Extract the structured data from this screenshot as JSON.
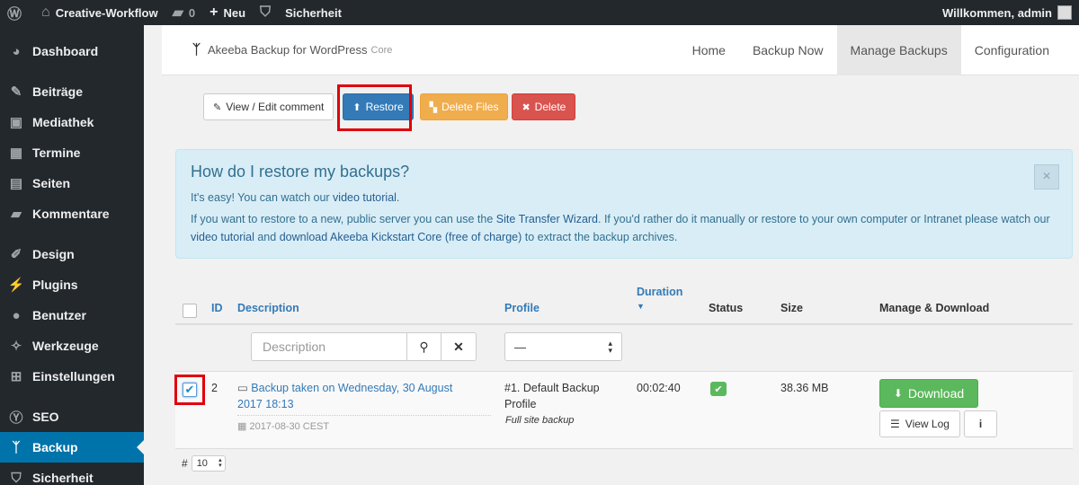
{
  "adminbar": {
    "site_name": "Creative-Workflow",
    "comments_count": "0",
    "new_label": "Neu",
    "security_label": "Sicherheit",
    "greeting": "Willkommen, admin"
  },
  "sidebar": {
    "items": [
      {
        "label": "Dashboard",
        "icon": "dashboard-icon"
      },
      {
        "label": "Beiträge",
        "icon": "pin-icon"
      },
      {
        "label": "Mediathek",
        "icon": "media-icon"
      },
      {
        "label": "Termine",
        "icon": "calendar-icon"
      },
      {
        "label": "Seiten",
        "icon": "pages-icon"
      },
      {
        "label": "Kommentare",
        "icon": "comment-icon"
      },
      {
        "label": "Design",
        "icon": "brush-icon"
      },
      {
        "label": "Plugins",
        "icon": "plugin-icon"
      },
      {
        "label": "Benutzer",
        "icon": "user-icon"
      },
      {
        "label": "Werkzeuge",
        "icon": "wrench-icon"
      },
      {
        "label": "Einstellungen",
        "icon": "settings-icon"
      },
      {
        "label": "SEO",
        "icon": "seo-icon"
      },
      {
        "label": "Backup",
        "icon": "backup-icon"
      },
      {
        "label": "Sicherheit",
        "icon": "shield-icon"
      }
    ]
  },
  "topnav": {
    "brand": "Akeeba Backup for WordPress",
    "brand_suffix": "Core",
    "links": [
      "Home",
      "Backup Now",
      "Manage Backups",
      "Configuration"
    ],
    "active": "Manage Backups"
  },
  "toolbar": {
    "edit_comment": "View / Edit comment",
    "restore": "Restore",
    "delete_files": "Delete Files",
    "delete": "Delete"
  },
  "info": {
    "title": "How do I restore my backups?",
    "line1_prefix": "It's easy! You can watch our ",
    "line1_link": "video tutorial",
    "line1_suffix": ".",
    "line2_a": "If you want to restore to a new, public server you can use the ",
    "line2_link1": "Site Transfer Wizard",
    "line2_b": ". If you'd rather do it manually or restore to your own computer or Intranet please watch our ",
    "line2_link2": "video tutorial",
    "line2_c": " and ",
    "line2_link3": "download Akeeba Kickstart Core (free of charge)",
    "line2_d": " to extract the backup archives.",
    "close": "×"
  },
  "table": {
    "headers": {
      "id": "ID",
      "description": "Description",
      "profile": "Profile",
      "duration": "Duration",
      "status": "Status",
      "size": "Size",
      "manage": "Manage & Download"
    },
    "filter": {
      "description_placeholder": "Description",
      "profile_selected": "—"
    },
    "rows": [
      {
        "id": "2",
        "description": "Backup taken on Wednesday, 30 August 2017 18:13",
        "date": "2017-08-30 CEST",
        "profile": "#1. Default Backup Profile",
        "profile_type": "Full site backup",
        "duration": "00:02:40",
        "size": "38.36 MB",
        "download_label": "Download",
        "view_log_label": "View Log",
        "checked": true
      }
    ]
  },
  "pager": {
    "hash": "#",
    "limit": "10"
  },
  "colors": {
    "primary": "#337ab7",
    "warning": "#f0ad4e",
    "danger": "#d9534f",
    "success": "#5cb85c",
    "highlight": "#e0000b"
  }
}
